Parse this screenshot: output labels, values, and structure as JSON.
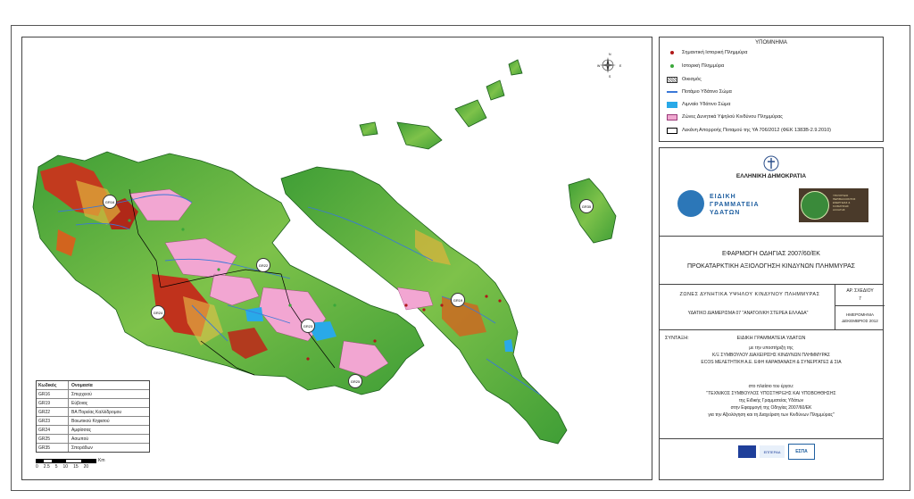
{
  "legend": {
    "title": "ΥΠΟΜΝΗΜΑ",
    "items": [
      {
        "label": "Σημαντική Ιστορική Πλημμύρα",
        "color": "#b01818"
      },
      {
        "label": "Ιστορική Πλημμύρα",
        "color": "#3aa83a"
      },
      {
        "label": "Οικισμός",
        "color": "#888888"
      },
      {
        "label": "Ποτάμιο Υδάτινο Σώμα",
        "color": "#3a78d8"
      },
      {
        "label": "Λιμναίο Υδάτινο Σώμα",
        "color": "#29a9e8"
      },
      {
        "label": "Ζώνες Δυνητικά Υψηλού Κινδύνου Πλημμύρας",
        "color": "#f0a8d0"
      },
      {
        "label": "Λεκάνη Απορροής Ποταμού της ΥΑ 706/2012 (ΦΕΚ 1383Β-2.9.2010)",
        "color": "#000000"
      }
    ]
  },
  "title_block": {
    "state": "ΕΛΛΗΝΙΚΗ ΔΗΜΟΚΡΑΤΙΑ",
    "agency_logo_text": [
      "ΕΙΔΙΚΗ",
      "ΓΡΑΜΜΑΤΕΙΑ",
      "ΥΔΑΤΩΝ"
    ],
    "ministry_logo_text": [
      "ΥΠΟΥΡΓΕΙΟ",
      "ΠΕΡΙΒΑΛΛΟΝΤΟΣ",
      "ΕΝΕΡΓΕΙΑΣ &",
      "ΚΛΙΜΑΤΙΚΗΣ",
      "ΑΛΛΑΓΗΣ"
    ],
    "project_line1": "ΕΦΑΡΜΟΓΗ ΟΔΗΓΙΑΣ 2007/60/ΕΚ",
    "project_line2": "ΠΡΟΚΑΤΑΡΚΤΙΚΗ ΑΞΙΟΛΟΓΗΣΗ ΚΙΝΔΥΝΩΝ ΠΛΗΜΜΥΡΑΣ",
    "map_title": "ΖΩΝΕΣ ΔΥΝΗΤΙΚΑ ΥΨΗΛΟΥ ΚΙΝΔΥΝΟΥ ΠΛΗΜΜΥΡΑΣ",
    "district": "ΥΔΑΤΙΚΟ ΔΙΑΜΕΡΙΣΜΑ 07 \"ΑΝΑΤΟΛΙΚΗ ΣΤΕΡΕΑ ΕΛΛΑΔΑ\"",
    "drawing_no_label": "ΑΡ. ΣΧΕΔΙΟΥ",
    "drawing_no": "7",
    "date_label": "ΗΜΕΡΟΜΗΝΙΑ",
    "date": "ΔΕΚΕΜΒΡΙΟΣ 2012",
    "syntaxi_label": "ΣΥΝΤΑΞΗ:",
    "syntaxi": "ΕΙΔΙΚΗ ΓΡΑΜΜΑΤΕΙΑ ΥΔΑΤΩΝ",
    "support_line": "με την υποστήριξη της",
    "consortium1": "Κ/Ξ ΣΥΜΒΟΥΛΟΥ ΔΙΑΧΕΙΡΙΣΗΣ ΚΙΝΔΥΝΩΝ ΠΛΗΜΜΥΡΑΣ",
    "consortium2": "ECOS ΜΕΛΕΤΗΤΙΚΗ Α.Ε. ΕΦΗ ΚΑΡΑΘΑΝΑΣΗ & ΣΥΝΕΡΓΑΤΕΣ & ΣΙΑ",
    "framework1": "στο πλαίσιο του έργου:",
    "framework2": "\"ΤΕΧΝΙΚΟΣ ΣΥΜΒΟΥΛΟΣ ΥΠΟΣΤΗΡΙΞΗΣ ΚΑΙ ΥΠΟΒΟΗΘΗΣΗΣ",
    "framework3": "της Ειδικής Γραμματείας Υδάτων",
    "framework4": "στην Εφαρμογή της Οδηγίας 2007/60/ΕΚ",
    "framework5": "για την Αξιολόγηση και τη Διαχείριση των Κινδύνων Πλημμύρας\"",
    "espa": "ΕΣΠΑ",
    "eu_program": "ΕΠΠΕΡΑΑ"
  },
  "basins_table": {
    "headers": [
      "Κωδικός",
      "Ονομασία"
    ],
    "rows": [
      [
        "GR16",
        "Σπερχειού"
      ],
      [
        "GR19",
        "Εύβοιας"
      ],
      [
        "GR22",
        "ΒΑ Πορείας Καλλίδρομου"
      ],
      [
        "GR23",
        "Βοιωτικού Κηφισού"
      ],
      [
        "GR24",
        "Αμφίσσας"
      ],
      [
        "GR25",
        "Ασωπού"
      ],
      [
        "GR35",
        "Σποράδων"
      ]
    ]
  },
  "scale": {
    "ticks": [
      "0",
      "2.5",
      "5",
      "10",
      "15",
      "20"
    ],
    "unit": "Km"
  },
  "map_labels": [
    "GR16",
    "GR22",
    "GR24",
    "GR23",
    "GR19",
    "GR25",
    "GR35"
  ],
  "compass": {
    "n": "N",
    "s": "S",
    "e": "E",
    "w": "W"
  }
}
